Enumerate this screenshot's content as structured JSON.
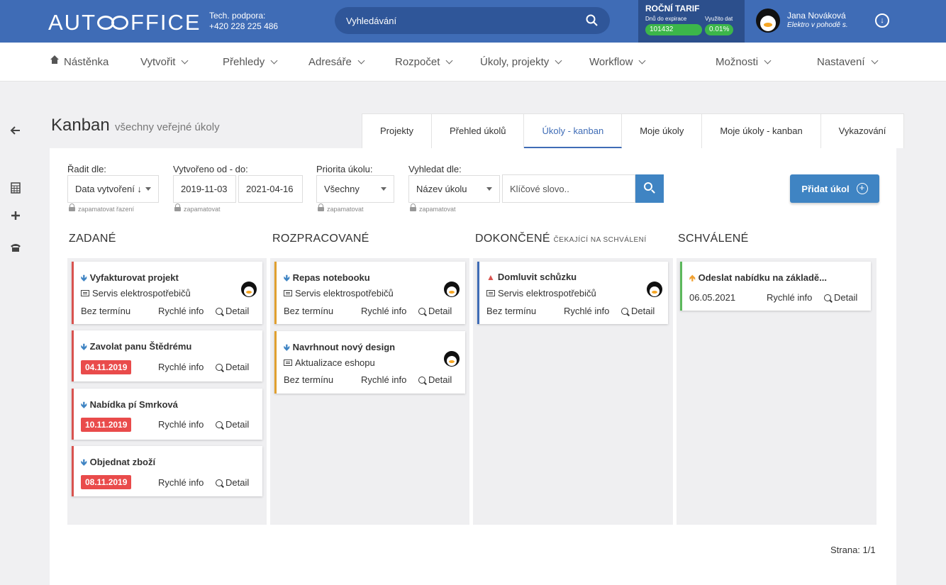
{
  "header": {
    "logo": "AUTOFFICE",
    "logo_left": "AUT",
    "logo_right": "FFICE",
    "support_label": "Tech. podpora:",
    "support_phone": "+420 228 225 486",
    "search_placeholder": "Vyhledávání",
    "tarif": {
      "title": "ROČNÍ TARIF",
      "days_label": "Dnů do expirace",
      "data_label": "Využito dat",
      "days_value": "101432",
      "data_value": "0.01%"
    },
    "user": {
      "name": "Jana Nováková",
      "company": "Elektro v pohodě s."
    }
  },
  "nav": {
    "items": [
      {
        "label": "Nástěnka"
      },
      {
        "label": "Vytvořit"
      },
      {
        "label": "Přehledy"
      },
      {
        "label": "Adresáře"
      },
      {
        "label": "Rozpočet"
      },
      {
        "label": "Úkoly, projekty"
      },
      {
        "label": "Workflow"
      },
      {
        "label": "Možnosti"
      },
      {
        "label": "Nastavení"
      }
    ]
  },
  "page": {
    "title": "Kanban",
    "subtitle": "všechny veřejné úkoly",
    "tabs": [
      {
        "label": "Projekty"
      },
      {
        "label": "Přehled úkolů"
      },
      {
        "label": "Úkoly - kanban"
      },
      {
        "label": "Moje úkoly"
      },
      {
        "label": "Moje úkoly - kanban"
      },
      {
        "label": "Vykazování"
      }
    ],
    "active_tab": "Úkoly - kanban"
  },
  "filters": {
    "sort_label": "Řadit dle:",
    "sort_value": "Data vytvoření ↓",
    "sort_note": "zapamatovat řazení",
    "created_label": "Vytvořeno od - do:",
    "created_from": "2019-11-03",
    "created_to": "2021-04-16",
    "created_note": "zapamatovat",
    "priority_label": "Priorita úkolu:",
    "priority_value": "Všechny",
    "priority_note": "zapamatovat",
    "searchby_label": "Vyhledat dle:",
    "searchby_value": "Název úkolu",
    "searchby_note": "zapamatovat",
    "keyword_placeholder": "Klíčové slovo..",
    "add_button": "Přidat úkol"
  },
  "columns": [
    {
      "title": "ZADANÉ",
      "sub": ""
    },
    {
      "title": "ROZPRACOVANÉ",
      "sub": ""
    },
    {
      "title": "DOKONČENÉ",
      "sub": "ČEKAJÍCÍ NA SCHVÁLENÍ"
    },
    {
      "title": "SCHVÁLENÉ",
      "sub": ""
    }
  ],
  "cards": {
    "c1": {
      "title": "Vyfakturovat projekt",
      "project": "Servis elektrospotřebičů",
      "term": "Bez termínu"
    },
    "c2": {
      "title": "Zavolat panu Štědrému",
      "date": "04.11.2019"
    },
    "c3": {
      "title": "Nabídka pí Smrková",
      "date": "10.11.2019"
    },
    "c4": {
      "title": "Objednat zboží",
      "date": "08.11.2019"
    },
    "c5": {
      "title": "Repas notebooku",
      "project": "Servis elektrospotřebičů",
      "term": "Bez termínu"
    },
    "c6": {
      "title": "Navrhnout nový design",
      "project": "Aktualizace eshopu",
      "term": "Bez termínu"
    },
    "c7": {
      "title": "Domluvit schůzku",
      "project": "Servis elektrospotřebičů",
      "term": "Bez termínu"
    },
    "c8": {
      "title": "Odeslat nabídku na základě...",
      "date": "06.05.2021"
    },
    "quick_info": "Rychlé info",
    "detail": "Detail"
  },
  "pager": "Strana: 1/1",
  "colors": {
    "brand": "#3f6cb6",
    "red": "#d9534f",
    "orange": "#e0a030",
    "blue": "#3f6cb6",
    "green": "#5cb85c",
    "date_red": "#e94b4b"
  }
}
